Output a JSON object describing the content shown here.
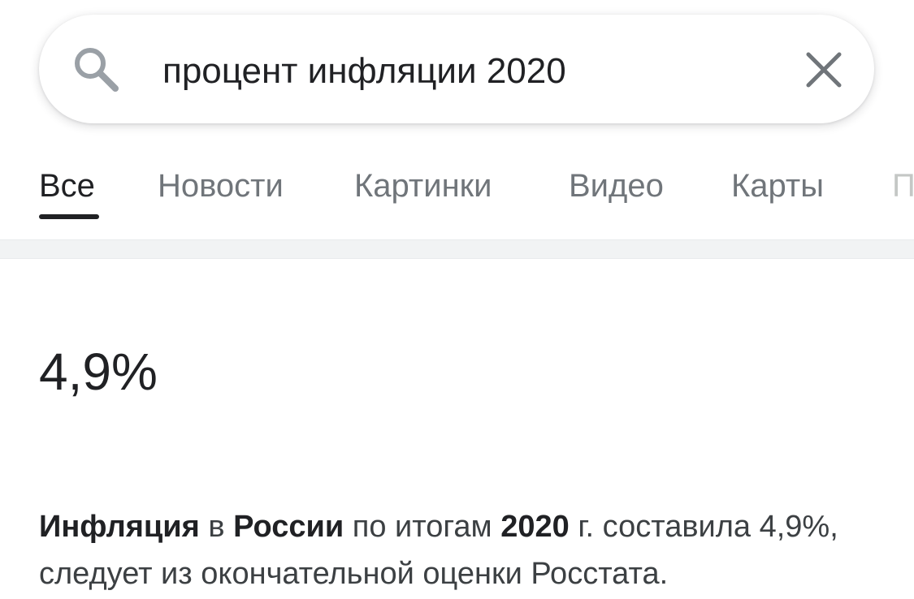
{
  "search": {
    "query": "процент инфляции 2020"
  },
  "tabs": [
    {
      "label": "Все",
      "active": true
    },
    {
      "label": "Новости",
      "active": false
    },
    {
      "label": "Картинки",
      "active": false
    },
    {
      "label": "Видео",
      "active": false
    },
    {
      "label": "Карты",
      "active": false
    },
    {
      "label": "П",
      "active": false
    }
  ],
  "answer": {
    "value": "4,9%"
  },
  "snippet": {
    "parts": [
      {
        "text": "Инфляция",
        "bold": true
      },
      {
        "text": " в ",
        "bold": false
      },
      {
        "text": "России",
        "bold": true
      },
      {
        "text": " по итогам ",
        "bold": false
      },
      {
        "text": "2020",
        "bold": true
      },
      {
        "text": " г. составила 4,9%, следует из окончательной оценки Росстата.",
        "bold": false
      }
    ]
  },
  "icons": {
    "search": "search-icon",
    "clear": "close-icon"
  },
  "colors": {
    "text_primary": "#202124",
    "text_secondary": "#70757a",
    "divider": "#f1f3f4"
  }
}
